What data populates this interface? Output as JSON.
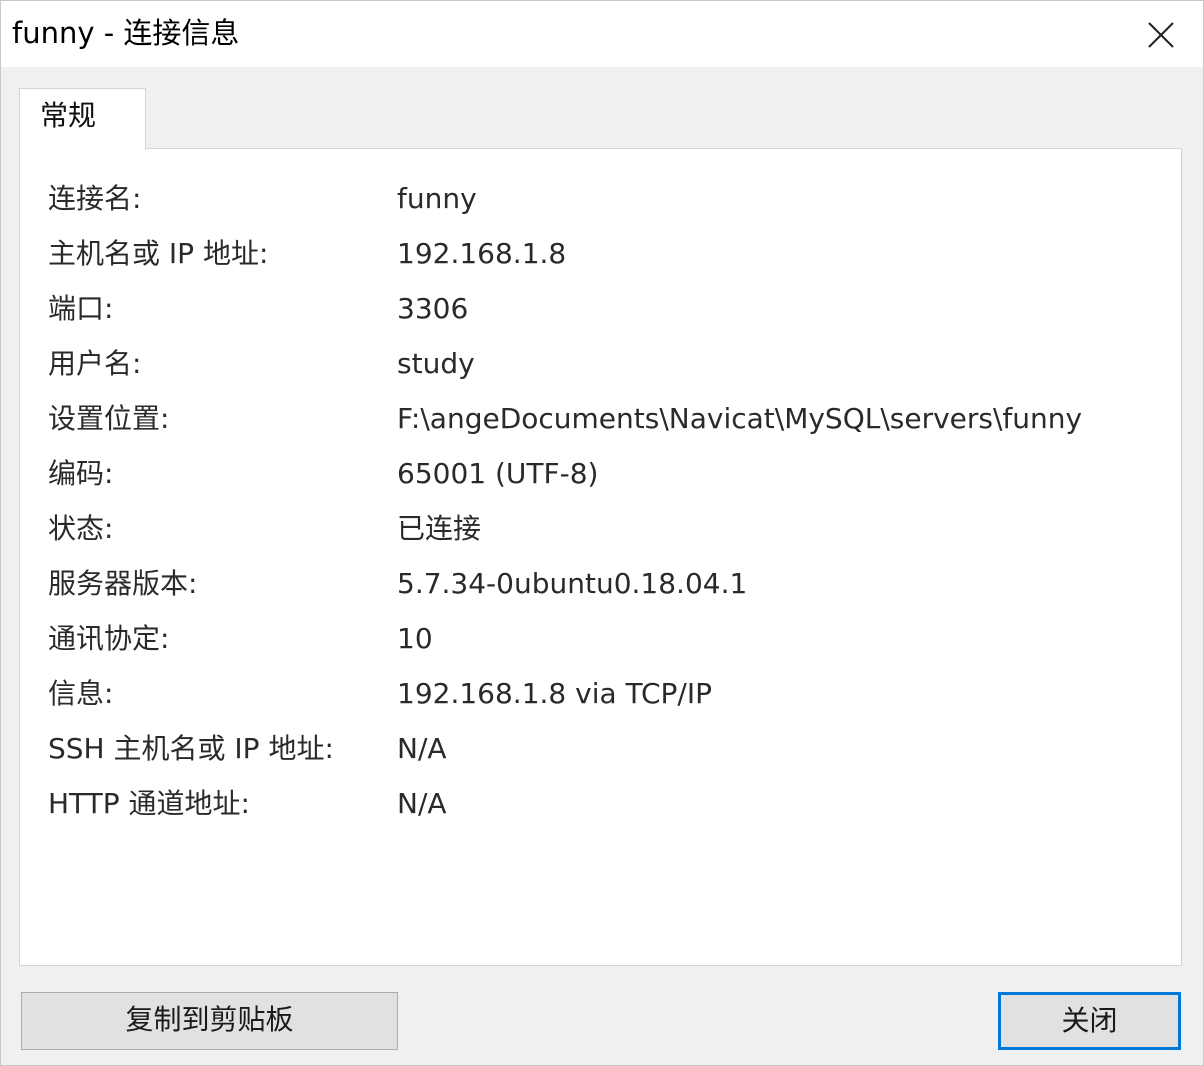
{
  "window": {
    "title": "funny - 连接信息"
  },
  "tabs": [
    {
      "label": "常规",
      "active": true
    }
  ],
  "fields": [
    {
      "label": "连接名:",
      "value": "funny"
    },
    {
      "label": "主机名或 IP 地址:",
      "value": "192.168.1.8"
    },
    {
      "label": "端口:",
      "value": "3306"
    },
    {
      "label": "用户名:",
      "value": "study"
    },
    {
      "label": "设置位置:",
      "value": "F:\\angeDocuments\\Navicat\\MySQL\\servers\\funny"
    },
    {
      "label": "编码:",
      "value": "65001 (UTF-8)"
    },
    {
      "label": "状态:",
      "value": "已连接"
    },
    {
      "label": "服务器版本:",
      "value": "5.7.34-0ubuntu0.18.04.1"
    },
    {
      "label": "通讯协定:",
      "value": "10"
    },
    {
      "label": "信息:",
      "value": "192.168.1.8 via TCP/IP"
    },
    {
      "label": "SSH 主机名或 IP 地址:",
      "value": "N/A"
    },
    {
      "label": "HTTP 通道地址:",
      "value": "N/A"
    }
  ],
  "buttons": {
    "copy_label": "复制到剪贴板",
    "close_label": "关闭"
  },
  "colors": {
    "focus_border": "#0078d7",
    "button_face": "#e1e1e1",
    "dialog_background": "#f0f0f0"
  }
}
